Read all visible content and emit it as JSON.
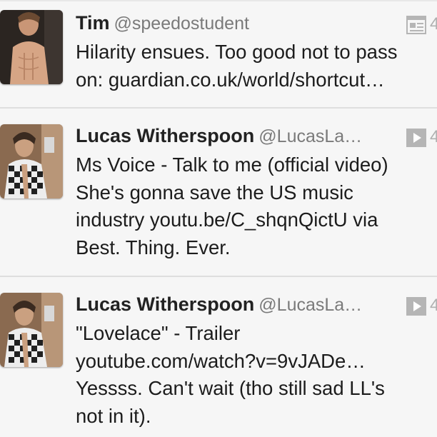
{
  "tweets": [
    {
      "name": "Tim",
      "handle": "@speedostudent",
      "lines": [
        "Hilarity ensues. Too good not to pass",
        "on: guardian.co.uk/world/shortcut…"
      ],
      "media_icon": "article-icon",
      "time": "4"
    },
    {
      "name": "Lucas Witherspoon",
      "handle": "@LucasLa…",
      "lines": [
        "Ms Voice - Talk to me (official video)",
        "She's gonna save the US music",
        "industry youtu.be/C_shqnQictU via",
        "Best. Thing. Ever."
      ],
      "media_icon": "video-play-icon",
      "time": "4"
    },
    {
      "name": "Lucas Witherspoon",
      "handle": "@LucasLa…",
      "lines": [
        "\"Lovelace\" - Trailer",
        "youtube.com/watch?v=9vJADe…",
        "Yessss. Can't wait (tho still sad LL's",
        "not in it)."
      ],
      "media_icon": "video-play-icon",
      "time": "4"
    }
  ],
  "colors": {
    "background": "#f6f6f6",
    "name": "#222222",
    "handle": "#7a7a7a",
    "divider": "#dedede",
    "icon": "#b5b5b5"
  }
}
